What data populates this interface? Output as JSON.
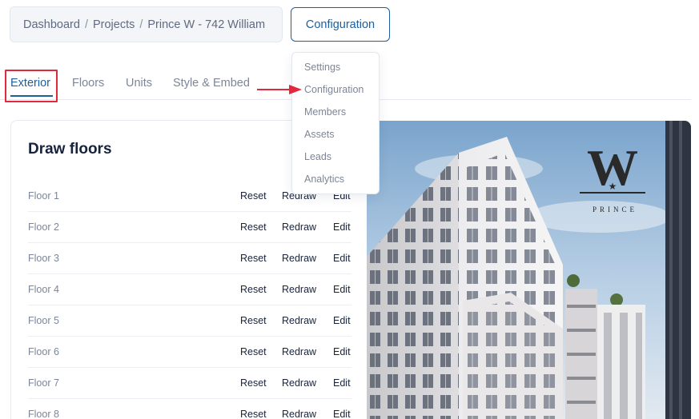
{
  "breadcrumb": {
    "items": [
      "Dashboard",
      "Projects",
      "Prince W - 742 William"
    ],
    "separator": "/"
  },
  "header": {
    "config_button": "Configuration"
  },
  "dropdown": {
    "items": [
      "Settings",
      "Configuration",
      "Members",
      "Assets",
      "Leads",
      "Analytics"
    ]
  },
  "tabs": {
    "items": [
      "Exterior",
      "Floors",
      "Units",
      "Style & Embed"
    ],
    "active": "Exterior"
  },
  "card": {
    "title": "Draw floors",
    "floors": [
      {
        "name": "Floor 1",
        "reset": "Reset",
        "redraw": "Redraw",
        "edit": "Edit"
      },
      {
        "name": "Floor 2",
        "reset": "Reset",
        "redraw": "Redraw",
        "edit": "Edit"
      },
      {
        "name": "Floor 3",
        "reset": "Reset",
        "redraw": "Redraw",
        "edit": "Edit"
      },
      {
        "name": "Floor 4",
        "reset": "Reset",
        "redraw": "Redraw",
        "edit": "Edit"
      },
      {
        "name": "Floor 5",
        "reset": "Reset",
        "redraw": "Redraw",
        "edit": "Edit"
      },
      {
        "name": "Floor 6",
        "reset": "Reset",
        "redraw": "Redraw",
        "edit": "Edit"
      },
      {
        "name": "Floor 7",
        "reset": "Reset",
        "redraw": "Redraw",
        "edit": "Edit"
      },
      {
        "name": "Floor 8",
        "reset": "Reset",
        "redraw": "Redraw",
        "edit": "Edit"
      }
    ]
  },
  "photo": {
    "logo_letter": "W",
    "logo_text": "PRINCE"
  },
  "colors": {
    "accent": "#1d5e9e",
    "annotation_red": "#e1283c",
    "text_dark": "#17233d",
    "text_muted": "#7c8698"
  },
  "icons": {
    "annotation_arrow": "arrow-right-icon"
  }
}
